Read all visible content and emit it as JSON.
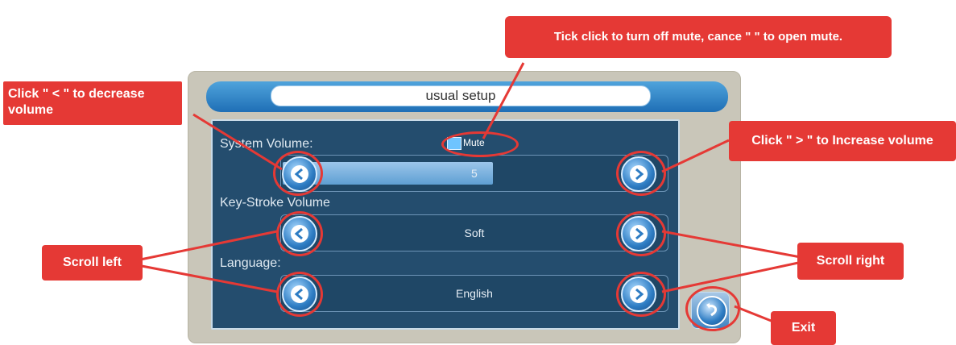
{
  "window": {
    "title": "usual setup"
  },
  "system_volume": {
    "label": "System Volume:",
    "value": "5",
    "level_fraction": 0.55,
    "mute_label": "Mute",
    "mute_checked": false
  },
  "key_stroke_volume": {
    "label": "Key-Stroke Volume",
    "value": "Soft"
  },
  "language": {
    "label": "Language:",
    "value": "English"
  },
  "callouts": {
    "mute": "Tick click to turn off mute, cance \"   \" to open mute.",
    "decrease": "Click \" < \" to decrease volume",
    "increase": "Click \" > \" to Increase volume",
    "scroll_left": "Scroll left",
    "scroll_right": "Scroll right",
    "exit": "Exit"
  },
  "colors": {
    "accent": "#e53935",
    "panel": "#244d6e",
    "button": "#2d7cc3"
  }
}
